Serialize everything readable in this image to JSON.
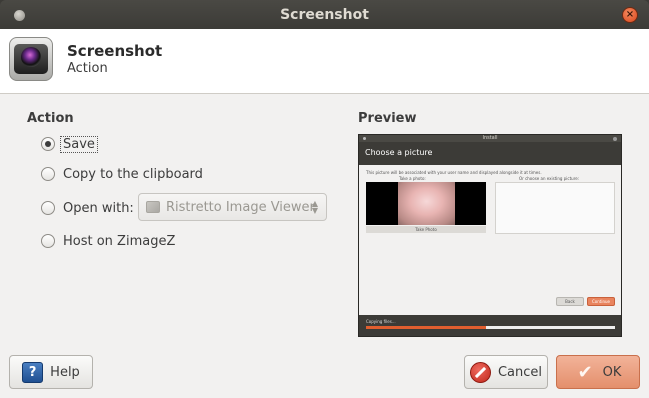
{
  "window": {
    "title": "Screenshot"
  },
  "header": {
    "title": "Screenshot",
    "subtitle": "Action",
    "icon": "camera-icon"
  },
  "action": {
    "label": "Action",
    "options": [
      {
        "label": "Save",
        "checked": true
      },
      {
        "label": "Copy to the clipboard",
        "checked": false
      },
      {
        "label": "Open with:",
        "checked": false
      },
      {
        "label": "Host on ZimageZ",
        "checked": false
      }
    ],
    "open_with_app": "Ristretto Image Viewer"
  },
  "preview": {
    "label": "Preview",
    "window_title": "Install",
    "header": "Choose a picture",
    "description": "This picture will be associated with your user name and displayed alongside it at times.",
    "take_photo_label": "Take a photo:",
    "choose_existing_label": "Or choose an existing picture:",
    "take_photo_button": "Take Photo",
    "back_button": "Back",
    "continue_button": "Continue",
    "status": "Copying files...",
    "progress": 0.48
  },
  "buttons": {
    "help": "Help",
    "cancel": "Cancel",
    "ok": "OK"
  },
  "colors": {
    "accent": "#e48f6c",
    "titlebar": "#3c3b37",
    "progress": "#e05e2f"
  }
}
